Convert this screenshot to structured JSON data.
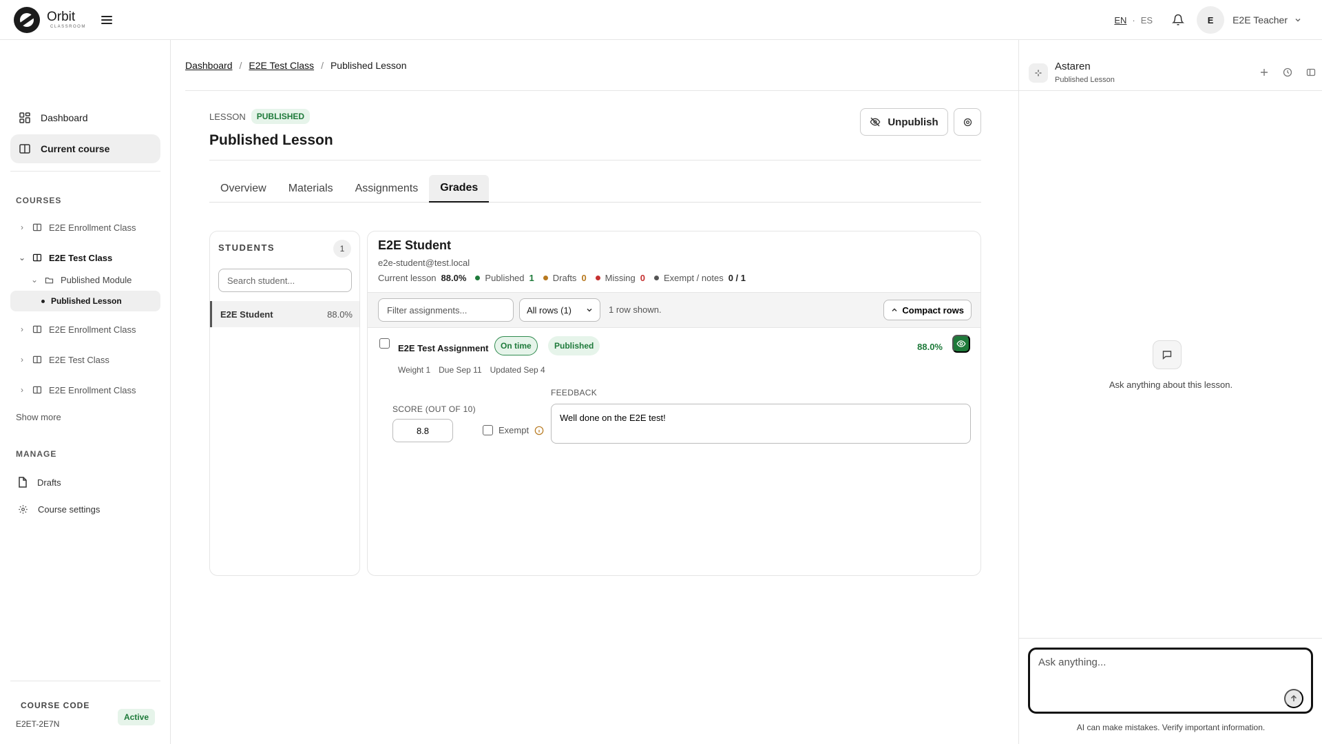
{
  "brand": {
    "name": "Orbit",
    "sub": "CLASSROOM"
  },
  "topbar": {
    "lang_en": "EN",
    "lang_sep": "·",
    "lang_es": "ES",
    "avatar_initial": "E",
    "user_name": "E2E Teacher"
  },
  "sidebar": {
    "nav": [
      {
        "label": "Dashboard",
        "icon": "dashboard-icon"
      },
      {
        "label": "Current course",
        "icon": "book-icon"
      }
    ],
    "courses_label": "COURSES",
    "courses": [
      {
        "label": "E2E Enrollment Class",
        "expanded": false
      },
      {
        "label": "E2E Test Class",
        "expanded": true
      },
      {
        "label": "Published Module",
        "type": "module"
      },
      {
        "label": "Published Lesson",
        "type": "lesson",
        "selected": true
      },
      {
        "label": "E2E Enrollment Class",
        "expanded": false
      },
      {
        "label": "E2E Test Class",
        "expanded": false
      },
      {
        "label": "E2E Enrollment Class",
        "expanded": false
      }
    ],
    "show_more": "Show more",
    "manage_label": "MANAGE",
    "manage": [
      {
        "label": "Drafts",
        "icon": "file-icon"
      },
      {
        "label": "Course settings",
        "icon": "gear-icon"
      }
    ],
    "course_code_label": "COURSE CODE",
    "course_code": "E2ET-2E7N",
    "course_status": "Active"
  },
  "breadcrumb": [
    "Dashboard",
    "E2E Test Class",
    "Published Lesson"
  ],
  "breadcrumb_sep": "/",
  "lesson": {
    "kicker": "LESSON",
    "status": "PUBLISHED",
    "title": "Published Lesson",
    "unpublish_label": "Unpublish"
  },
  "tabs": [
    "Overview",
    "Materials",
    "Assignments",
    "Grades"
  ],
  "active_tab": "Grades",
  "students": {
    "label": "STUDENTS",
    "count": "1",
    "search_placeholder": "Search student...",
    "list": [
      {
        "name": "E2E Student",
        "percent": "88.0%"
      }
    ]
  },
  "detail": {
    "name": "E2E Student",
    "email": "e2e-student@test.local",
    "current_lesson_label": "Current lesson",
    "current_lesson_value": "88.0%",
    "published_label": "Published",
    "published_value": "1",
    "drafts_label": "Drafts",
    "drafts_value": "0",
    "missing_label": "Missing",
    "missing_value": "0",
    "exempt_label": "Exempt / notes",
    "exempt_value": "0 / 1",
    "filter_placeholder": "Filter assignments...",
    "rows_select": "All rows (1)",
    "rows_shown": "1 row shown.",
    "compact_label": "Compact rows",
    "colors": {
      "published": "#1e7a3a",
      "drafts": "#b7791f",
      "missing": "#c53030",
      "exempt": "#555555"
    }
  },
  "assignment": {
    "title": "E2E Test Assignment",
    "timing_badge": "On time",
    "status_badge": "Published",
    "percent": "88.0%",
    "weight": "Weight 1",
    "due": "Due Sep 11",
    "updated": "Updated Sep 4",
    "score_label": "SCORE (OUT OF 10)",
    "score_value": "8.8",
    "exempt_label": "Exempt",
    "feedback_label": "FEEDBACK",
    "feedback_value": "Well done on the E2E test!"
  },
  "assistant": {
    "title": "Astaren",
    "subtitle": "Published Lesson",
    "empty_text": "Ask anything about this lesson.",
    "input_placeholder": "Ask anything...",
    "disclaimer": "AI can make mistakes. Verify important information."
  }
}
